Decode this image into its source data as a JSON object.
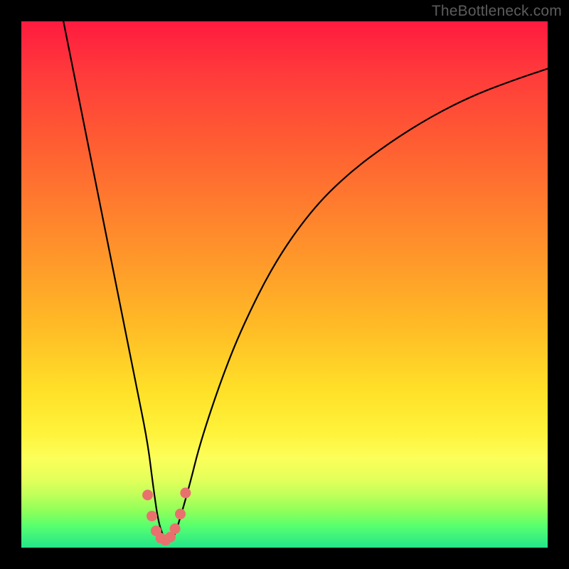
{
  "watermark": "TheBottleneck.com",
  "chart_data": {
    "type": "line",
    "title": "",
    "xlabel": "",
    "ylabel": "",
    "xlim": [
      0,
      100
    ],
    "ylim": [
      0,
      100
    ],
    "background_gradient": {
      "top": "#ff1a3f",
      "bottom": "#24e58a",
      "note": "vertical gradient red→orange→yellow→green mapped to y=100→0"
    },
    "series": [
      {
        "name": "bottleneck-curve",
        "stroke": "#000000",
        "x": [
          8,
          10,
          12,
          14,
          16,
          18,
          20,
          22,
          24,
          25,
          26,
          27,
          28,
          29,
          30,
          32,
          34,
          38,
          42,
          48,
          55,
          62,
          70,
          78,
          86,
          94,
          100
        ],
        "y": [
          100,
          90,
          80,
          70,
          60,
          50,
          40,
          30,
          20,
          12,
          5,
          2,
          1,
          2,
          5,
          12,
          20,
          32,
          42,
          54,
          64,
          71,
          77,
          82,
          86,
          89,
          91
        ]
      }
    ],
    "markers": {
      "name": "highlight-points",
      "fill": "#e8716e",
      "x": [
        24.0,
        24.8,
        25.6,
        26.5,
        27.4,
        28.3,
        29.2,
        30.2,
        31.2
      ],
      "y": [
        10.0,
        6.0,
        3.2,
        1.8,
        1.4,
        2.0,
        3.6,
        6.4,
        10.4
      ]
    }
  }
}
